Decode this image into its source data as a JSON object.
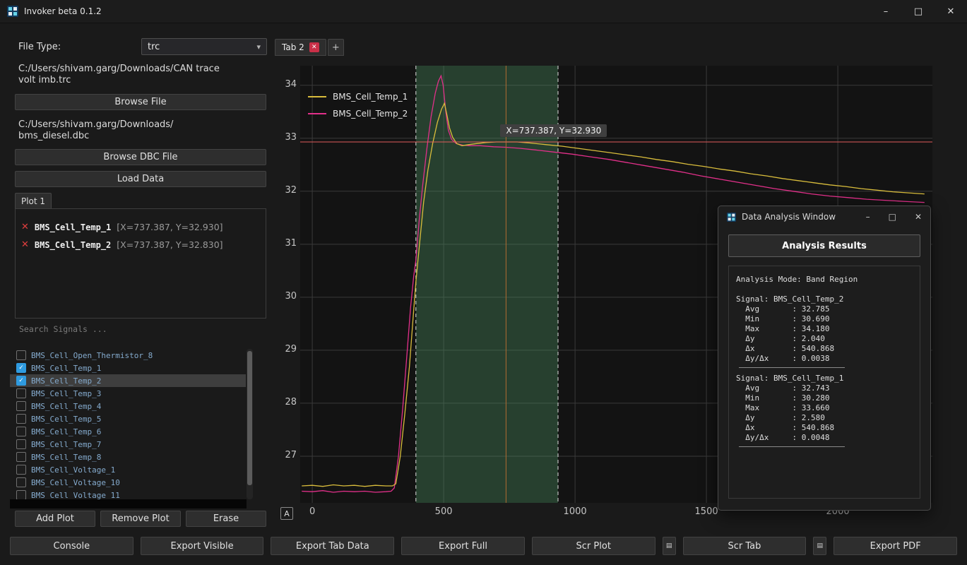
{
  "colors": {
    "accent": "#2f9be0",
    "grid": "#3a3a3a",
    "band_fill": "rgba(77,148,99,0.35)",
    "band_edge": "#dcdcdc",
    "crosshair_v": "#b06a30",
    "crosshair_h": "#e25b5b"
  },
  "icons": {
    "remove": "✕",
    "check": "✓",
    "combo_arrow": "▾",
    "menu": "▤"
  },
  "titlebar": {
    "title": "Invoker beta 0.1.2",
    "minimize": "–",
    "maximize": "□",
    "close": "✕"
  },
  "left_panel": {
    "file_type_label": "File Type:",
    "file_type_value": "trc",
    "trace_path": "C:/Users/shivam.garg/Downloads/CAN trace\nvolt imb.trc",
    "browse_file": "Browse File",
    "dbc_path": "C:/Users/shivam.garg/Downloads/\nbms_diesel.dbc",
    "browse_dbc": "Browse DBC File",
    "load_data": "Load Data",
    "plot_tab": "Plot 1",
    "legend": [
      {
        "name": "BMS_Cell_Temp_1",
        "value": "[X=737.387, Y=32.930]"
      },
      {
        "name": "BMS_Cell_Temp_2",
        "value": "[X=737.387, Y=32.830]"
      }
    ],
    "search_placeholder": "Search Signals ...",
    "signals": [
      {
        "label": "BMS_Cell_Open_Thermistor_8",
        "checked": false,
        "selected": false
      },
      {
        "label": "BMS_Cell_Temp_1",
        "checked": true,
        "selected": false
      },
      {
        "label": "BMS_Cell_Temp_2",
        "checked": true,
        "selected": true
      },
      {
        "label": "BMS_Cell_Temp_3",
        "checked": false,
        "selected": false
      },
      {
        "label": "BMS_Cell_Temp_4",
        "checked": false,
        "selected": false
      },
      {
        "label": "BMS_Cell_Temp_5",
        "checked": false,
        "selected": false
      },
      {
        "label": "BMS_Cell_Temp_6",
        "checked": false,
        "selected": false
      },
      {
        "label": "BMS_Cell_Temp_7",
        "checked": false,
        "selected": false
      },
      {
        "label": "BMS_Cell_Temp_8",
        "checked": false,
        "selected": false
      },
      {
        "label": "BMS_Cell_Voltage_1",
        "checked": false,
        "selected": false
      },
      {
        "label": "BMS_Cell_Voltage_10",
        "checked": false,
        "selected": false
      },
      {
        "label": "BMS_Cell_Voltage_11",
        "checked": false,
        "selected": false
      }
    ],
    "add_plot": "Add Plot",
    "remove_plot": "Remove Plot",
    "erase": "Erase"
  },
  "tabs": {
    "active_label": "Tab 2",
    "close": "✕",
    "add_label": "+"
  },
  "plot": {
    "autoscale_label": "A",
    "tooltip": "X=737.387, Y=32.930"
  },
  "analysis_window": {
    "title": "Data Analysis Window",
    "minimize": "–",
    "maximize": "□",
    "close": "✕",
    "results_header": "Analysis Results",
    "mode_line": "Analysis Mode: Band Region",
    "sections": [
      {
        "signal": "Signal: BMS_Cell_Temp_2",
        "rows": [
          [
            "Avg",
            "32.785"
          ],
          [
            "Min",
            "30.690"
          ],
          [
            "Max",
            "34.180"
          ],
          [
            "Δy",
            "2.040"
          ],
          [
            "Δx",
            "540.868"
          ],
          [
            "Δy/Δx",
            "0.0038"
          ]
        ]
      },
      {
        "signal": "Signal: BMS_Cell_Temp_1",
        "rows": [
          [
            "Avg",
            "32.743"
          ],
          [
            "Min",
            "30.280"
          ],
          [
            "Max",
            "33.660"
          ],
          [
            "Δy",
            "2.580"
          ],
          [
            "Δx",
            "540.868"
          ],
          [
            "Δy/Δx",
            "0.0048"
          ]
        ]
      }
    ]
  },
  "bottom_bar": {
    "console": "Console",
    "export_visible": "Export Visible",
    "export_tab_data": "Export Tab Data",
    "export_full": "Export Full",
    "scr_plot": "Scr Plot",
    "scr_tab": "Scr Tab",
    "export_pdf": "Export PDF"
  },
  "chart_data": {
    "type": "line",
    "title": "",
    "xlabel": "",
    "ylabel": "",
    "xlim": [
      -46,
      2360
    ],
    "ylim": [
      26.12,
      34.37
    ],
    "xticks": [
      0,
      500,
      1000,
      1500,
      2000
    ],
    "yticks": [
      27,
      28,
      29,
      30,
      31,
      32,
      33,
      34
    ],
    "grid": true,
    "legend_position": "top-left",
    "band_region": [
      394.3,
      935.2
    ],
    "crosshair": {
      "x": 737.387,
      "y": 32.93
    },
    "series": [
      {
        "name": "BMS_Cell_Temp_1",
        "color": "#d9bd3c",
        "points": [
          [
            -40,
            26.44
          ],
          [
            0,
            26.45
          ],
          [
            40,
            26.43
          ],
          [
            80,
            26.46
          ],
          [
            120,
            26.44
          ],
          [
            160,
            26.45
          ],
          [
            200,
            26.43
          ],
          [
            240,
            26.45
          ],
          [
            280,
            26.44
          ],
          [
            305,
            26.44
          ],
          [
            318,
            26.48
          ],
          [
            335,
            27.0
          ],
          [
            352,
            27.8
          ],
          [
            370,
            28.7
          ],
          [
            382,
            29.5
          ],
          [
            394,
            30.28
          ],
          [
            408,
            31.0
          ],
          [
            424,
            31.8
          ],
          [
            440,
            32.4
          ],
          [
            458,
            32.9
          ],
          [
            476,
            33.3
          ],
          [
            492,
            33.55
          ],
          [
            503,
            33.66
          ],
          [
            512,
            33.45
          ],
          [
            522,
            33.2
          ],
          [
            534,
            33.02
          ],
          [
            550,
            32.9
          ],
          [
            570,
            32.86
          ],
          [
            595,
            32.88
          ],
          [
            625,
            32.9
          ],
          [
            660,
            32.92
          ],
          [
            700,
            32.93
          ],
          [
            737,
            32.93
          ],
          [
            780,
            32.93
          ],
          [
            830,
            32.91
          ],
          [
            890,
            32.88
          ],
          [
            950,
            32.85
          ],
          [
            1010,
            32.81
          ],
          [
            1070,
            32.77
          ],
          [
            1130,
            32.73
          ],
          [
            1190,
            32.69
          ],
          [
            1250,
            32.65
          ],
          [
            1310,
            32.6
          ],
          [
            1370,
            32.56
          ],
          [
            1430,
            32.51
          ],
          [
            1490,
            32.47
          ],
          [
            1550,
            32.42
          ],
          [
            1610,
            32.38
          ],
          [
            1670,
            32.33
          ],
          [
            1730,
            32.29
          ],
          [
            1790,
            32.24
          ],
          [
            1850,
            32.2
          ],
          [
            1910,
            32.16
          ],
          [
            1970,
            32.12
          ],
          [
            2030,
            32.09
          ],
          [
            2090,
            32.05
          ],
          [
            2150,
            32.02
          ],
          [
            2210,
            31.99
          ],
          [
            2270,
            31.97
          ],
          [
            2330,
            31.95
          ]
        ]
      },
      {
        "name": "BMS_Cell_Temp_2",
        "color": "#e2308a",
        "points": [
          [
            -40,
            26.34
          ],
          [
            0,
            26.33
          ],
          [
            40,
            26.35
          ],
          [
            80,
            26.32
          ],
          [
            120,
            26.34
          ],
          [
            160,
            26.33
          ],
          [
            200,
            26.34
          ],
          [
            240,
            26.32
          ],
          [
            280,
            26.33
          ],
          [
            300,
            26.34
          ],
          [
            312,
            26.4
          ],
          [
            328,
            27.0
          ],
          [
            344,
            27.9
          ],
          [
            360,
            28.9
          ],
          [
            374,
            29.8
          ],
          [
            386,
            30.4
          ],
          [
            394,
            30.69
          ],
          [
            406,
            31.4
          ],
          [
            420,
            32.1
          ],
          [
            436,
            32.8
          ],
          [
            452,
            33.4
          ],
          [
            468,
            33.85
          ],
          [
            480,
            34.08
          ],
          [
            490,
            34.18
          ],
          [
            498,
            34.0
          ],
          [
            508,
            33.5
          ],
          [
            518,
            33.15
          ],
          [
            530,
            32.98
          ],
          [
            548,
            32.9
          ],
          [
            572,
            32.87
          ],
          [
            600,
            32.86
          ],
          [
            640,
            32.86
          ],
          [
            690,
            32.84
          ],
          [
            737,
            32.83
          ],
          [
            790,
            32.81
          ],
          [
            850,
            32.78
          ],
          [
            920,
            32.74
          ],
          [
            990,
            32.7
          ],
          [
            1060,
            32.65
          ],
          [
            1130,
            32.6
          ],
          [
            1200,
            32.54
          ],
          [
            1270,
            32.48
          ],
          [
            1340,
            32.42
          ],
          [
            1410,
            32.36
          ],
          [
            1480,
            32.29
          ],
          [
            1550,
            32.23
          ],
          [
            1620,
            32.17
          ],
          [
            1690,
            32.11
          ],
          [
            1760,
            32.05
          ],
          [
            1830,
            32.0
          ],
          [
            1900,
            31.95
          ],
          [
            1970,
            31.91
          ],
          [
            2040,
            31.88
          ],
          [
            2110,
            31.85
          ],
          [
            2180,
            31.83
          ],
          [
            2250,
            31.81
          ],
          [
            2330,
            31.79
          ]
        ]
      }
    ]
  }
}
